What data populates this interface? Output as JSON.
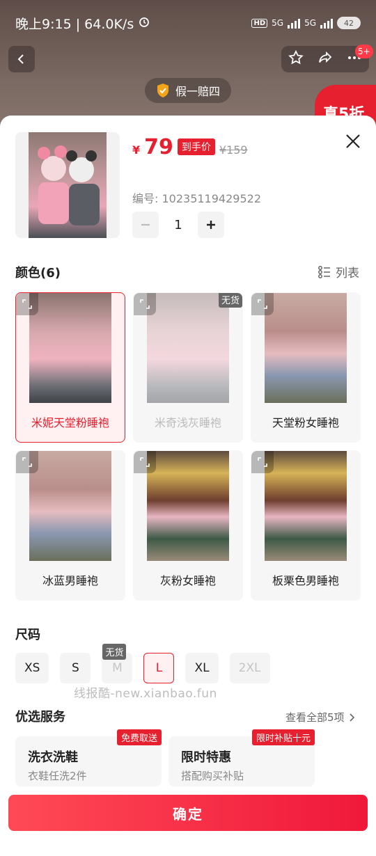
{
  "status_bar": {
    "time": "晚上9:15 | 64.0K/s",
    "network1": "5G",
    "network2": "5G",
    "hd": "HD",
    "battery": "42"
  },
  "nav": {
    "back_icon": "chevron-left-icon",
    "star_icon": "star-icon",
    "share_icon": "share-icon",
    "more_icon": "more-icon",
    "badge": "5+"
  },
  "guarantee": {
    "label": "假一赔四"
  },
  "promo_corner": {
    "label": "真5折"
  },
  "product": {
    "price_symbol": "¥",
    "price": "79",
    "price_tag": "到手价",
    "original_price": "¥159",
    "code": "编号: 10235119429522",
    "quantity": "1"
  },
  "color_section": {
    "title": "颜色(6)",
    "list_toggle": "列表",
    "options": [
      {
        "label": "米妮天堂粉睡袍",
        "state": "selected",
        "img": "pink",
        "oos": ""
      },
      {
        "label": "米奇浅灰睡袍",
        "state": "dim",
        "img": "pink",
        "oos": "无货"
      },
      {
        "label": "天堂粉女睡袍",
        "state": "normal",
        "img": "room",
        "oos": ""
      },
      {
        "label": "冰蓝男睡袍",
        "state": "normal",
        "img": "room",
        "oos": ""
      },
      {
        "label": "灰粉女睡袍",
        "state": "normal",
        "img": "xmas",
        "oos": ""
      },
      {
        "label": "板栗色男睡袍",
        "state": "normal",
        "img": "xmas",
        "oos": ""
      }
    ]
  },
  "size_section": {
    "title": "尺码",
    "sizes": [
      {
        "label": "XS",
        "state": "normal",
        "oos": ""
      },
      {
        "label": "S",
        "state": "normal",
        "oos": ""
      },
      {
        "label": "M",
        "state": "dim",
        "oos": "无货"
      },
      {
        "label": "L",
        "state": "sel",
        "oos": ""
      },
      {
        "label": "XL",
        "state": "normal",
        "oos": ""
      },
      {
        "label": "2XL",
        "state": "dim",
        "oos": ""
      }
    ]
  },
  "watermark": "线报酷-new.xianbao.fun",
  "service_section": {
    "title": "优选服务",
    "see_all": "查看全部5项",
    "items": [
      {
        "title": "洗衣洗鞋",
        "sub": "衣鞋任洗2件",
        "badge": "免费取送"
      },
      {
        "title": "限时特惠",
        "sub": "搭配购买补贴",
        "badge": "限时补贴十元"
      }
    ]
  },
  "confirm": "确定",
  "colors": {
    "accent": "#e6202e"
  }
}
